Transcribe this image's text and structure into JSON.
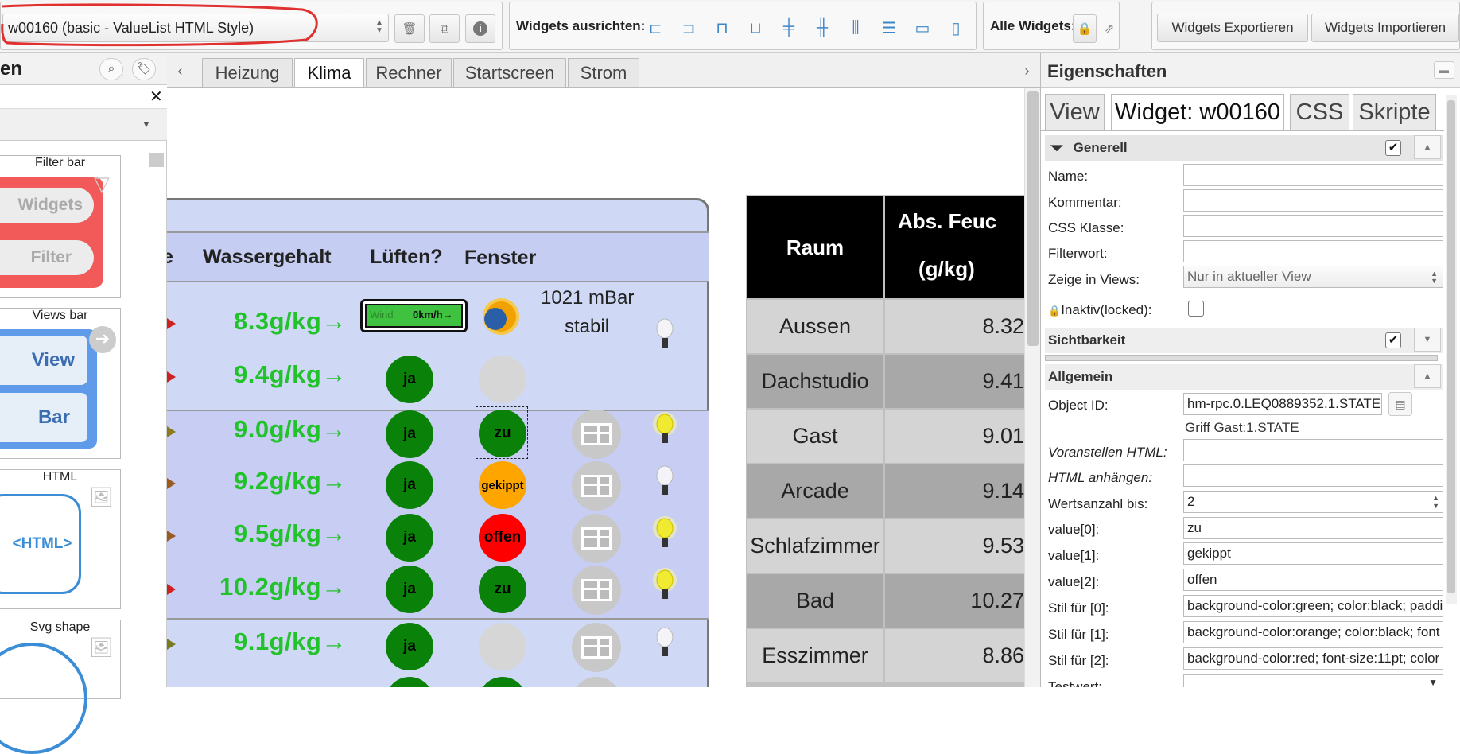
{
  "toolbar": {
    "widget_select": "w00160 (basic - ValueList HTML Style)",
    "align_label": "Widgets ausrichten:",
    "all_widgets_label": "Alle Widgets:",
    "export_label": "Widgets Exportieren",
    "import_label": "Widgets Importieren"
  },
  "palette": {
    "header": "en",
    "cards": [
      {
        "title": "Filter bar",
        "btn1": "Widgets",
        "btn2": "Filter"
      },
      {
        "title": "Views bar",
        "btn1": "View",
        "btn2": "Bar"
      },
      {
        "title": "HTML",
        "content": "<HTML>"
      },
      {
        "title": "Svg shape"
      }
    ]
  },
  "tabs": [
    "Heizung",
    "Klima",
    "Rechner",
    "Startscreen",
    "Strom"
  ],
  "active_tab": "Klima",
  "climate": {
    "headers": {
      "partial": "e",
      "water": "Wassergehalt",
      "air": "Lüften?",
      "window": "Fenster"
    },
    "weather_sensor": {
      "label": "Wind",
      "value": "0km/h→"
    },
    "pressure": "1021 mBar",
    "pressure_trend": "stabil",
    "rows": [
      {
        "water": "8.3g/kg→",
        "air": "",
        "window": "",
        "bulb": "off"
      },
      {
        "water": "9.4g/kg→",
        "air": "ja",
        "window": "",
        "bulb": "none"
      },
      {
        "water": "9.0g/kg→",
        "air": "ja",
        "window": "zu",
        "bulb": "on"
      },
      {
        "water": "9.2g/kg→",
        "air": "ja",
        "window": "gekippt",
        "bulb": "off"
      },
      {
        "water": "9.5g/kg→",
        "air": "ja",
        "window": "offen",
        "bulb": "on"
      },
      {
        "water": "10.2g/kg→",
        "air": "ja",
        "window": "zu",
        "bulb": "on"
      },
      {
        "water": "9.1g/kg→",
        "air": "ja",
        "window": "",
        "bulb": "off"
      }
    ],
    "colors": {
      "window_zu": "#0a820a",
      "window_gekippt": "#ffa500",
      "window_offen": "#ff0000",
      "value_green": "#22c22a"
    }
  },
  "room_table": {
    "header_room": "Raum",
    "header_abs_1": "Abs. Feuc",
    "header_abs_2": "(g/kg)",
    "rows": [
      {
        "room": "Aussen",
        "value": "8.32"
      },
      {
        "room": "Dachstudio",
        "value": "9.41"
      },
      {
        "room": "Gast",
        "value": "9.01"
      },
      {
        "room": "Arcade",
        "value": "9.14"
      },
      {
        "room": "Schlafzimmer",
        "value": "9.53"
      },
      {
        "room": "Bad",
        "value": "10.27"
      },
      {
        "room": "Esszimmer",
        "value": "8.86"
      }
    ]
  },
  "properties": {
    "title": "Eigenschaften",
    "tabs": [
      "View",
      "Widget: w00160",
      "CSS",
      "Skripte"
    ],
    "sections": {
      "general": "Generell",
      "visibility": "Sichtbarkeit",
      "common": "Allgemein"
    },
    "fields": {
      "name": {
        "label": "Name:",
        "value": ""
      },
      "comment": {
        "label": "Kommentar:",
        "value": ""
      },
      "css_class": {
        "label": "CSS Klasse:",
        "value": ""
      },
      "filter": {
        "label": "Filterwort:",
        "value": ""
      },
      "show_in_views": {
        "label": "Zeige in Views:",
        "value": "Nur in aktueller View"
      },
      "locked": {
        "label": "Inaktiv(locked):"
      },
      "object_id": {
        "label": "Object ID:",
        "value": "hm-rpc.0.LEQ0889352.1.STATE"
      },
      "object_name": "Griff Gast:1.STATE",
      "prepend_html": {
        "label": "Voranstellen HTML:",
        "value": ""
      },
      "append_html": {
        "label": "HTML anhängen:",
        "value": ""
      },
      "count": {
        "label": "Wertsanzahl bis:",
        "value": "2"
      },
      "value0": {
        "label": "value[0]:",
        "value": "zu"
      },
      "value1": {
        "label": "value[1]:",
        "value": "gekippt"
      },
      "value2": {
        "label": "value[2]:",
        "value": "offen"
      },
      "style0": {
        "label": "Stil für [0]:",
        "value": "background-color:green; color:black; padding"
      },
      "style1": {
        "label": "Stil für [1]:",
        "value": "background-color:orange; color:black; font"
      },
      "style2": {
        "label": "Stil für [2]:",
        "value": "background-color:red; font-size:11pt; color"
      },
      "test": {
        "label": "Testwert:"
      }
    }
  }
}
